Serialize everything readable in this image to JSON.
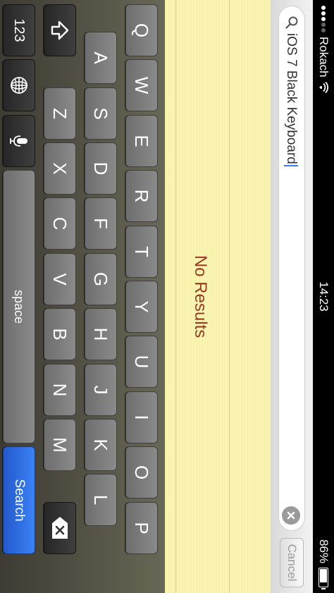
{
  "status_bar": {
    "carrier": "Rokach",
    "time": "14:23",
    "battery_percent_label": "86%",
    "battery_level": 0.86
  },
  "search_bar": {
    "query": "iOS 7 Black Keyboard",
    "cancel_label": "Cancel"
  },
  "content": {
    "no_results_label": "No Results"
  },
  "keyboard": {
    "row1": [
      "Q",
      "W",
      "E",
      "R",
      "T",
      "Y",
      "U",
      "I",
      "O",
      "P"
    ],
    "row2": [
      "A",
      "S",
      "D",
      "F",
      "G",
      "H",
      "J",
      "K",
      "L"
    ],
    "row3": [
      "Z",
      "X",
      "C",
      "V",
      "B",
      "N",
      "M"
    ],
    "numbers_label": "123",
    "space_label": "space",
    "search_label": "Search"
  },
  "icons": {
    "search": "magnifier-icon",
    "clear": "x-circle-icon",
    "shift": "shift-arrow-icon",
    "delete": "backspace-icon",
    "globe": "globe-icon",
    "mic": "microphone-icon",
    "wifi": "wifi-icon",
    "battery": "battery-icon"
  },
  "colors": {
    "search_key": "#2f6fe0",
    "no_results_text": "#9a3a24",
    "content_bg": "#fbf5b1"
  }
}
